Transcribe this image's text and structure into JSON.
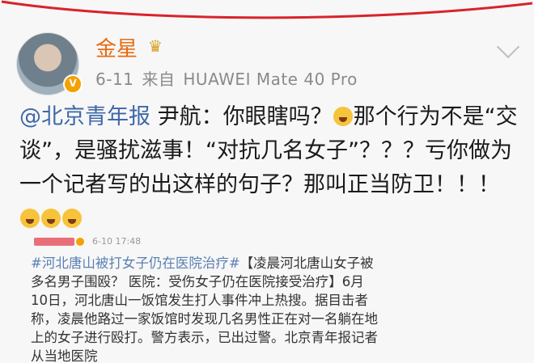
{
  "post": {
    "username": "金星",
    "date": "6-11",
    "source_prefix": "来自",
    "source_device": "HUAWEI Mate 40 Pro",
    "mention": "@北京青年报",
    "text_part1": "  尹航：你眼瞎吗？",
    "text_part2": "那个行为不是“交谈”，是骚扰滋事！“对抗几名女子”？？？亏你做为一个记者写的出这样的句子？那叫正当防卫！！！"
  },
  "quoted": {
    "time": "6-10 17:48",
    "hashtag": "#河北唐山被打女子仍在医院治疗#",
    "title": "【凌晨河北唐山女子被多名男子围殴？ 医院：受伤女子仍在医院接受治疗】",
    "body": "6月10日，河北唐山一饭馆发生打人事件冲上热搜。据目击者称，凌晨他路过一家饭馆时发现几名男性正在对一名躺在地上的女子进行殴打。警方表示，已出过警。北京青年报记者从当地医院"
  },
  "icons": {
    "verified_badge": "verified-v-badge",
    "crown": "crown-icon",
    "more": "chevron-down-icon",
    "emoji": "angry-face-emoji"
  },
  "colors": {
    "username": "#e86a10",
    "mention": "#3e68a8",
    "annotation": "#d8232a"
  }
}
